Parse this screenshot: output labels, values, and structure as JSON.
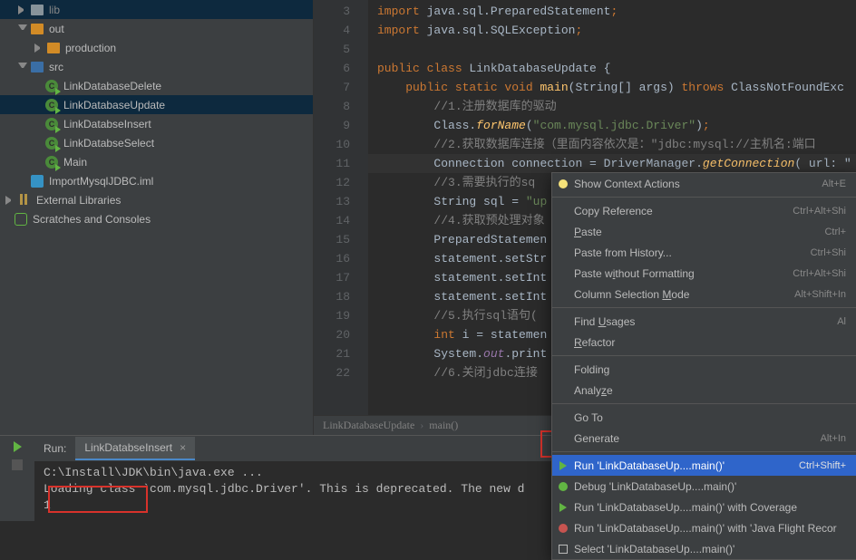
{
  "tree": {
    "folders": {
      "out": "out",
      "production": "production",
      "src": "src"
    },
    "classes": {
      "delete": "LinkDatabaseDelete",
      "update": "LinkDatabaseUpdate",
      "insert": "LinkDatabseInsert",
      "select": "LinkDatabseSelect",
      "main": "Main"
    },
    "iml": "ImportMysqlJDBC.iml",
    "ext_lib": "External Libraries",
    "scratch": "Scratches and Consoles"
  },
  "line_numbers": [
    "3",
    "4",
    "5",
    "6",
    "7",
    "8",
    "9",
    "10",
    "11",
    "12",
    "13",
    "14",
    "15",
    "16",
    "17",
    "18",
    "19",
    "20",
    "21",
    "22"
  ],
  "code": {
    "l3_import": "import ",
    "l3_pkg": "java.sql.PreparedStatement",
    "semi": ";",
    "l4_pkg": "java.sql.SQLException",
    "l6_public": "public class ",
    "l6_name": "LinkDatabaseUpdate",
    "l6_brace": " {",
    "l7_pub": "    public static void ",
    "l7_main": "main",
    "l7_args": "(String[] args) ",
    "l7_throws": "throws ",
    "l7_ex": "ClassNotFoundExc",
    "l8_cmt": "        //1.注册数据库的驱动",
    "l9_cls": "        Class.",
    "l9_for": "forName",
    "l9_p1": "(",
    "l9_str": "\"com.mysql.jdbc.Driver\"",
    "l9_p2": ")",
    "l10_cmt": "        //2.获取数据库连接（里面内容依次是：\"jdbc:mysql://主机名:端口",
    "l11_a": "        Connection ",
    "l11_b": "connection",
    "l11_c": " = ",
    "l11_d": "DriverManager",
    "l11_e": ".",
    "l11_f": "getConnection",
    "l11_g": "( url: \"",
    "l12_cmt": "        //3.需要执行的sq",
    "l13_a": "        String ",
    "l13_b": "sql",
    "l13_c": " = ",
    "l13_d": "\"up",
    "l14_cmt": "        //4.获取预处理对象",
    "l15_a": "        PreparedStatemen",
    "l16_a": "        statement.setStr",
    "l17_a": "        statement.setInt",
    "l18_a": "        statement.setInt",
    "l19_cmt": "        //5.执行sql语句(",
    "l20_a": "        int ",
    "l20_b": "i",
    "l20_c": " = statemen",
    "l21_a": "        System.",
    "l21_b": "out",
    "l21_c": ".print",
    "l22_cmt": "        //6.关闭jdbc连接"
  },
  "breadcrumb": {
    "a": "LinkDatabaseUpdate",
    "b": "main()"
  },
  "run": {
    "label": "Run:",
    "tab": "LinkDatabseInsert",
    "console_1": "C:\\Install\\JDK\\bin\\java.exe ...",
    "console_2": "Loading class `com.mysql.jdbc.Driver'. This is deprecated. The new d",
    "console_3": "1"
  },
  "ctx": {
    "show_ctx": "Show Context Actions",
    "show_ctx_sc": "Alt+E",
    "copy_ref": "Copy Reference",
    "copy_ref_sc": "Ctrl+Alt+Shi",
    "paste": "Paste",
    "paste_sc": "Ctrl+",
    "paste_hist": "Paste from History...",
    "paste_hist_sc": "Ctrl+Shi",
    "paste_wof": "Paste without Formatting",
    "paste_wof_sc": "Ctrl+Alt+Shi",
    "col_sel": "Column Selection Mode",
    "col_sel_sc": "Alt+Shift+In",
    "find_usages": "Find Usages",
    "find_usages_sc": "Al",
    "refactor": "Refactor",
    "folding": "Folding",
    "analyze": "Analyze",
    "goto": "Go To",
    "generate": "Generate",
    "generate_sc": "Alt+In",
    "run_item": "Run 'LinkDatabaseUp....main()'",
    "run_sc": "Ctrl+Shift+",
    "debug_item": "Debug 'LinkDatabaseUp....main()'",
    "cov_item": "Run 'LinkDatabaseUp....main()' with Coverage",
    "jfr_item": "Run 'LinkDatabaseUp....main()' with 'Java Flight Recor",
    "select_item": "Select 'LinkDatabaseUp....main()'"
  }
}
